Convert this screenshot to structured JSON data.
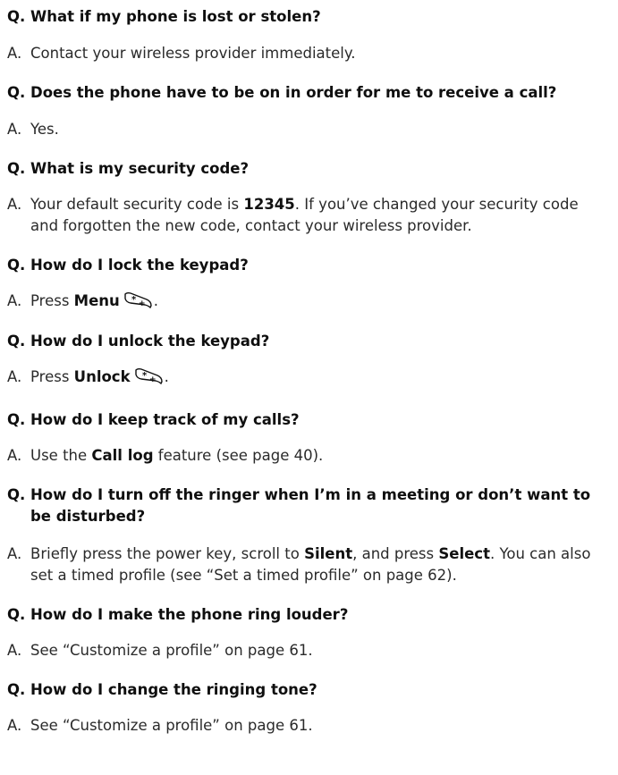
{
  "faq": [
    {
      "q_marker": "Q.",
      "a_marker": "A.",
      "question": "What if my phone is lost or stolen?",
      "answer_parts": [
        "Contact your wireless provider immediately."
      ]
    },
    {
      "q_marker": "Q.",
      "a_marker": "A.",
      "question": "Does the phone have to be on in order for me to receive a call?",
      "answer_parts": [
        "Yes."
      ]
    },
    {
      "q_marker": "Q.",
      "a_marker": "A.",
      "question": "What is my security code?",
      "answer_parts": [
        "Your default security code is ",
        "12345",
        ". If you’ve changed your security code and forgotten the new code, contact your wireless provider."
      ]
    },
    {
      "q_marker": "Q.",
      "a_marker": "A.",
      "question": "How do I lock the keypad?",
      "answer_parts": [
        "Press ",
        "Menu",
        ".",
        "star-key-icon"
      ]
    },
    {
      "q_marker": "Q.",
      "a_marker": "A.",
      "question": "How do I unlock the keypad?",
      "answer_parts": [
        "Press ",
        "Unlock",
        ".",
        "star-key-icon"
      ]
    },
    {
      "q_marker": "Q.",
      "a_marker": "A.",
      "question": "How do I keep track of my calls?",
      "answer_parts": [
        "Use the ",
        "Call log",
        " feature (see page 40)."
      ]
    },
    {
      "q_marker": "Q.",
      "a_marker": "A.",
      "question": "How do I turn off the ringer when I’m in a meeting or don’t want to be disturbed?",
      "answer_parts": [
        "Briefly press the power key, scroll to ",
        "Silent",
        ", and press ",
        "Select",
        ". You can also set a timed profile (see “Set a timed profile” on page 62)."
      ]
    },
    {
      "q_marker": "Q.",
      "a_marker": "A.",
      "question": "How do I make the phone ring louder?",
      "answer_parts": [
        "See “Customize a profile” on page 61."
      ]
    },
    {
      "q_marker": "Q.",
      "a_marker": "A.",
      "question": "How do I change the ringing tone?",
      "answer_parts": [
        "See “Customize a profile” on page 61."
      ]
    }
  ]
}
